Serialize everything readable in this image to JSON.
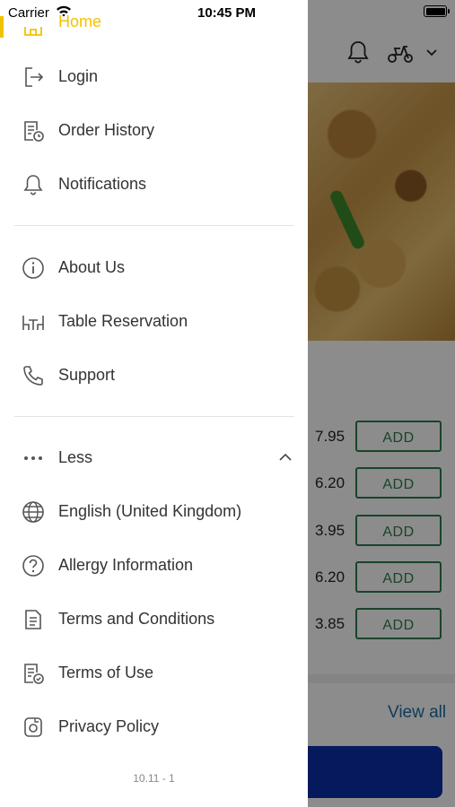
{
  "status_bar": {
    "carrier": "Carrier",
    "time": "10:45 PM"
  },
  "drawer": {
    "active_item": "Home",
    "items_group1": [
      {
        "label": "Login",
        "icon": "login-icon"
      },
      {
        "label": "Order History",
        "icon": "order-history-icon"
      },
      {
        "label": "Notifications",
        "icon": "bell-icon"
      }
    ],
    "items_group2": [
      {
        "label": "About Us",
        "icon": "info-icon"
      },
      {
        "label": "Table Reservation",
        "icon": "table-icon"
      },
      {
        "label": "Support",
        "icon": "phone-icon"
      }
    ],
    "less_label": "Less",
    "items_group3": [
      {
        "label": "English (United Kingdom)",
        "icon": "globe-icon"
      },
      {
        "label": "Allergy Information",
        "icon": "question-icon"
      },
      {
        "label": "Terms and Conditions",
        "icon": "document-icon"
      },
      {
        "label": "Terms of Use",
        "icon": "document-check-icon"
      },
      {
        "label": "Privacy Policy",
        "icon": "privacy-icon"
      }
    ],
    "version": "10.11 - 1"
  },
  "background": {
    "menu_rows": [
      {
        "price": "7.95",
        "button": "ADD"
      },
      {
        "price": "6.20",
        "button": "ADD"
      },
      {
        "price": "3.95",
        "button": "ADD"
      },
      {
        "price": "6.20",
        "button": "ADD"
      },
      {
        "price": "3.85",
        "button": "ADD"
      }
    ],
    "view_all": "View all"
  },
  "colors": {
    "accent": "#f2c200",
    "add_green": "#2e7d4f",
    "link_blue": "#1a6ea5",
    "primary_button": "#0b2fa8"
  }
}
